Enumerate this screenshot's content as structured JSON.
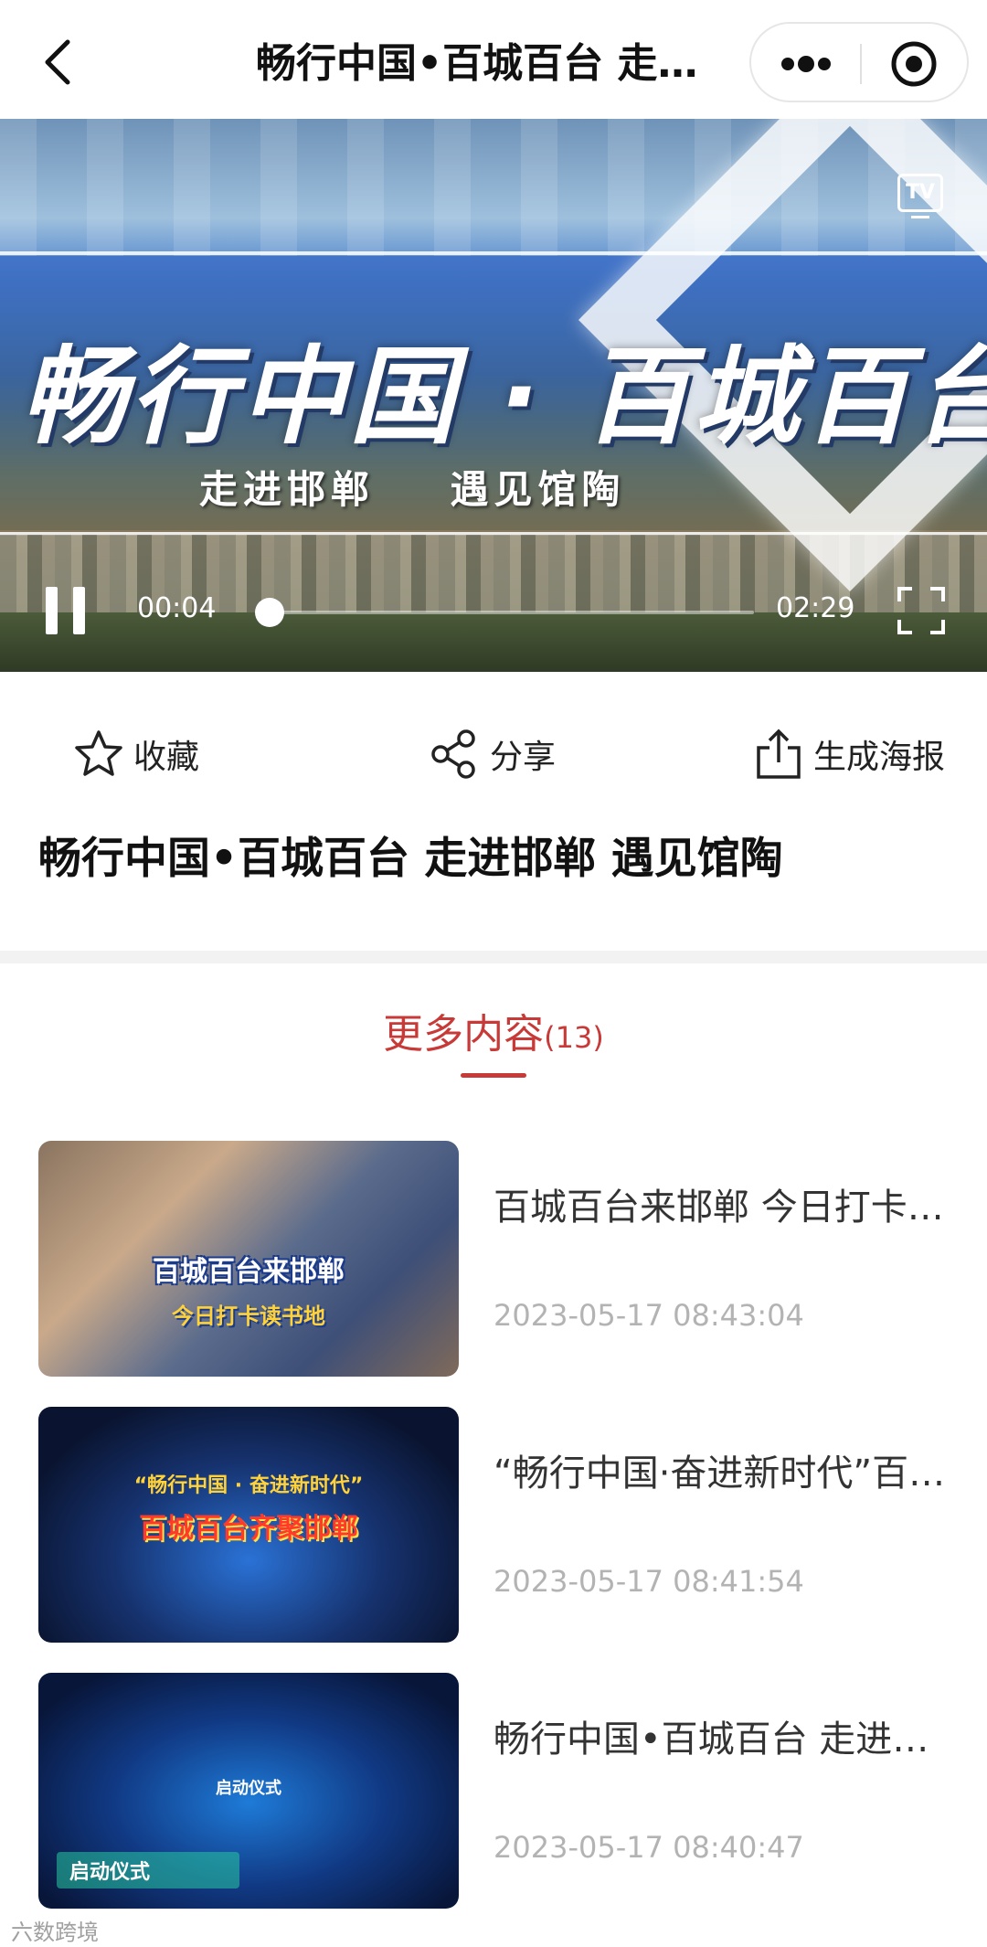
{
  "navbar": {
    "title": "畅行中国•百城百台 走进邯郸 遇见馆陶",
    "back_icon": "chevron-left-icon",
    "more_icon": "more-dots-icon",
    "close_icon": "target-close-icon"
  },
  "player": {
    "banner_title": "畅行中国 · 百城百台",
    "banner_subtitle": "走进邯郸    遇见馆陶",
    "tv_label": "TV",
    "current_time": "00:04",
    "total_time": "02:29",
    "progress": 0.027,
    "state": "playing"
  },
  "actions": {
    "favorite": {
      "label": "收藏",
      "icon": "star-icon"
    },
    "share": {
      "label": "分享",
      "icon": "share-icon"
    },
    "poster": {
      "label": "生成海报",
      "icon": "export-icon"
    }
  },
  "video_title": "畅行中国•百城百台 走进邯郸 遇见馆陶",
  "more": {
    "label": "更多内容",
    "count": "(13)",
    "accent_color": "#c73a37"
  },
  "items": [
    {
      "title": "百城百台来邯郸 今日打卡读书地",
      "date": "2023-05-17 08:43:04",
      "thumb_caption_1": "百城百台来邯郸",
      "thumb_caption_2": "今日打卡读书地"
    },
    {
      "title": "“畅行中国·奋进新时代”百城百台齐聚邯郸",
      "date": "2023-05-17 08:41:54",
      "thumb_caption_1": "“畅行中国 · 奋进新时代”",
      "thumb_caption_2": "百城百台齐聚邯郸"
    },
    {
      "title": "畅行中国•百城百台 走进邯郸启动仪式",
      "date": "2023-05-17 08:40:47",
      "thumb_caption_1": "启动仪式",
      "thumb_caption_2": "启动仪式"
    }
  ],
  "watermark": "六数跨境"
}
